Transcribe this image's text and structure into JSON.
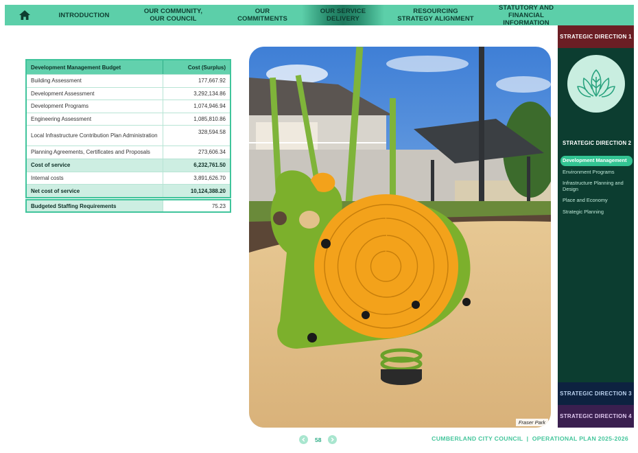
{
  "nav": {
    "home_icon": "home-icon",
    "items": [
      {
        "label": "INTRODUCTION",
        "active": false
      },
      {
        "label": "OUR COMMUNITY,\nOUR COUNCIL",
        "active": false
      },
      {
        "label": "OUR\nCOMMITMENTS",
        "active": false
      },
      {
        "label": "OUR SERVICE\nDELIVERY",
        "active": true
      },
      {
        "label": "RESOURCING\nSTRATEGY ALIGNMENT",
        "active": false
      },
      {
        "label": "STATUTORY AND\nFINANCIAL INFORMATION",
        "active": false
      }
    ]
  },
  "sidebar": {
    "direction1": "STRATEGIC DIRECTION 1",
    "direction2": "STRATEGIC DIRECTION 2",
    "direction3": "STRATEGIC DIRECTION 3",
    "direction4": "STRATEGIC DIRECTION 4",
    "items": [
      {
        "label": "Development Management",
        "active": true
      },
      {
        "label": "Environment Programs",
        "active": false
      },
      {
        "label": "Infrastructure Planning and Design",
        "active": false
      },
      {
        "label": "Place and Economy",
        "active": false
      },
      {
        "label": "Strategic Planning",
        "active": false
      }
    ],
    "colors": {
      "d1": "#6b1e24",
      "d2": "#0c3d30",
      "d3": "#0d2240",
      "d4": "#3a1f4f",
      "active": "#33c493"
    }
  },
  "budget": {
    "header": {
      "label": "Development Management Budget",
      "value": "Cost (Surplus)"
    },
    "rows": [
      {
        "label": "Building Assessment",
        "value": "177,667.92",
        "type": "plain"
      },
      {
        "label": "Development Assessment",
        "value": "3,292,134.86",
        "type": "plain"
      },
      {
        "label": "Development Programs",
        "value": "1,074,946.94",
        "type": "plain"
      },
      {
        "label": "Engineering Assessment",
        "value": "1,085,810.86",
        "type": "plain"
      },
      {
        "label": "Local Infrastructure Contribution Plan Administration",
        "value": "328,594.58",
        "type": "tall"
      },
      {
        "label": "Planning Agreements, Certificates and Proposals",
        "value": "273,606.34",
        "type": "plain"
      },
      {
        "label": "Cost of service",
        "value": "6,232,761.50",
        "type": "sub"
      },
      {
        "label": "Internal costs",
        "value": "3,891,626.70",
        "type": "plain"
      },
      {
        "label": "Net cost of service",
        "value": "10,124,388.20",
        "type": "sub"
      }
    ],
    "staffing": {
      "label": "Budgeted Staffing Requirements",
      "value": "75.23"
    }
  },
  "photo": {
    "caption": "Fraser Park"
  },
  "footer": {
    "page_number": "58",
    "prev_icon": "chevron-left-icon",
    "next_icon": "chevron-right-icon",
    "title": "CUMBERLAND CITY COUNCIL  |  OPERATIONAL PLAN 2025-2026"
  },
  "colors": {
    "accent": "#5ccfa9",
    "accent_dark": "#3fc49b",
    "accent_light": "#cdeee2"
  }
}
